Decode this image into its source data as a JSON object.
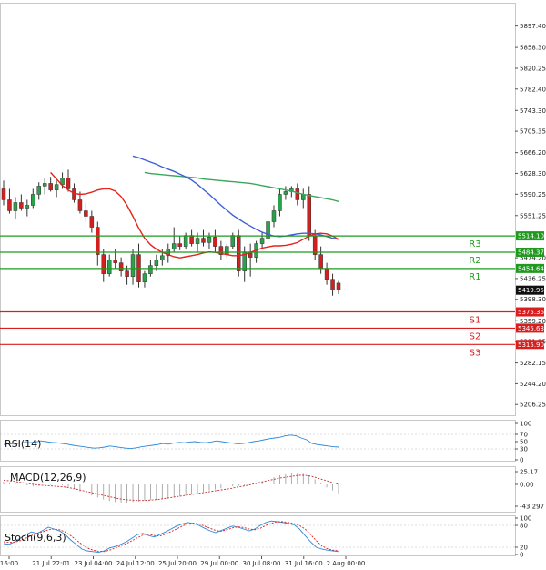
{
  "colors": {
    "bull": "#2aa14a",
    "bear": "#d21f1f",
    "ma_fast": "#e3241c",
    "ma_mid": "#3d5fd8",
    "ma_slow": "#3aa85a",
    "resistance": "#1f9a1f",
    "support": "#d81e1e",
    "rsi": "#2c86d8",
    "stoch_main": "#2c86d8",
    "stoch_signal": "#d81e1e",
    "hist": "#c33333"
  },
  "chart_data": [
    {
      "type": "candlestick",
      "name": "price",
      "y_ticks": [
        "5897.40",
        "5858.30",
        "5820.25",
        "5782.40",
        "5743.30",
        "5705.35",
        "5666.20",
        "5628.30",
        "5590.25",
        "5551.25",
        "5474.20",
        "5436.25",
        "5398.30",
        "5359.20",
        "5321.25",
        "5282.15",
        "5244.20",
        "5206.25"
      ],
      "ylim": [
        5190,
        5935
      ],
      "x_ticks": [
        "16:00",
        "21 Jul 22:01",
        "23 Jul 04:00",
        "24 Jul 12:00",
        "25 Jul 20:00",
        "29 Jul 00:00",
        "30 Jul 08:00",
        "31 Jul 16:00",
        "2 Aug 00:00"
      ],
      "candles": [
        [
          5600,
          5615,
          5570,
          5580
        ],
        [
          5580,
          5600,
          5555,
          5560
        ],
        [
          5560,
          5585,
          5545,
          5575
        ],
        [
          5575,
          5590,
          5560,
          5565
        ],
        [
          5565,
          5580,
          5550,
          5570
        ],
        [
          5570,
          5600,
          5565,
          5590
        ],
        [
          5590,
          5612,
          5580,
          5605
        ],
        [
          5605,
          5620,
          5590,
          5610
        ],
        [
          5610,
          5622,
          5595,
          5598
        ],
        [
          5598,
          5615,
          5585,
          5608
        ],
        [
          5608,
          5630,
          5600,
          5620
        ],
        [
          5620,
          5635,
          5595,
          5600
        ],
        [
          5600,
          5610,
          5575,
          5580
        ],
        [
          5580,
          5595,
          5555,
          5560
        ],
        [
          5560,
          5575,
          5540,
          5550
        ],
        [
          5550,
          5560,
          5520,
          5530
        ],
        [
          5530,
          5540,
          5460,
          5480
        ],
        [
          5480,
          5490,
          5430,
          5445
        ],
        [
          5445,
          5480,
          5440,
          5470
        ],
        [
          5470,
          5490,
          5455,
          5465
        ],
        [
          5465,
          5475,
          5440,
          5450
        ],
        [
          5450,
          5460,
          5425,
          5440
        ],
        [
          5440,
          5490,
          5425,
          5480
        ],
        [
          5480,
          5500,
          5420,
          5430
        ],
        [
          5430,
          5450,
          5420,
          5445
        ],
        [
          5445,
          5470,
          5440,
          5460
        ],
        [
          5460,
          5480,
          5450,
          5470
        ],
        [
          5470,
          5490,
          5460,
          5478
        ],
        [
          5478,
          5500,
          5465,
          5490
        ],
        [
          5490,
          5530,
          5485,
          5500
        ],
        [
          5500,
          5515,
          5488,
          5495
        ],
        [
          5495,
          5520,
          5490,
          5515
        ],
        [
          5515,
          5525,
          5495,
          5500
        ],
        [
          5500,
          5520,
          5485,
          5510
        ],
        [
          5510,
          5525,
          5495,
          5502
        ],
        [
          5502,
          5520,
          5490,
          5512
        ],
        [
          5512,
          5525,
          5485,
          5495
        ],
        [
          5495,
          5505,
          5470,
          5480
        ],
        [
          5480,
          5500,
          5475,
          5495
        ],
        [
          5495,
          5520,
          5490,
          5515
        ],
        [
          5515,
          5525,
          5440,
          5450
        ],
        [
          5450,
          5495,
          5430,
          5485
        ],
        [
          5485,
          5500,
          5440,
          5475
        ],
        [
          5475,
          5505,
          5465,
          5500
        ],
        [
          5500,
          5520,
          5490,
          5510
        ],
        [
          5510,
          5545,
          5505,
          5540
        ],
        [
          5540,
          5570,
          5530,
          5560
        ],
        [
          5560,
          5600,
          5550,
          5590
        ],
        [
          5590,
          5605,
          5580,
          5595
        ],
        [
          5595,
          5605,
          5585,
          5600
        ],
        [
          5600,
          5610,
          5570,
          5580
        ],
        [
          5580,
          5600,
          5565,
          5590
        ],
        [
          5590,
          5605,
          5505,
          5515
        ],
        [
          5515,
          5525,
          5470,
          5480
        ],
        [
          5480,
          5495,
          5445,
          5455
        ],
        [
          5455,
          5465,
          5425,
          5435
        ],
        [
          5435,
          5445,
          5405,
          5415
        ],
        [
          5428,
          5432,
          5408,
          5415
        ]
      ],
      "ma_fast": [
        5630,
        5618,
        5606,
        5598,
        5592,
        5590,
        5591,
        5594,
        5598,
        5600,
        5600,
        5596,
        5586,
        5570,
        5550,
        5528,
        5510,
        5498,
        5490,
        5484,
        5480,
        5476,
        5474,
        5476,
        5478,
        5480,
        5483,
        5485,
        5484,
        5482,
        5480,
        5478,
        5478,
        5480,
        5484,
        5488,
        5492,
        5494,
        5496,
        5496,
        5497,
        5499,
        5502,
        5508,
        5514,
        5518,
        5519,
        5518,
        5514,
        5508
      ],
      "ma_mid": [
        5660,
        5657,
        5653,
        5649,
        5645,
        5640,
        5636,
        5632,
        5627,
        5622,
        5616,
        5608,
        5599,
        5590,
        5580,
        5570,
        5561,
        5552,
        5545,
        5538,
        5532,
        5526,
        5521,
        5517,
        5514,
        5513,
        5514,
        5516,
        5518,
        5519,
        5519,
        5518,
        5516,
        5513,
        5510,
        5508
      ],
      "ma_slow": [
        5630,
        5628,
        5627,
        5626,
        5625,
        5624,
        5623,
        5622,
        5621,
        5620,
        5618,
        5617,
        5616,
        5615,
        5614,
        5613,
        5612,
        5611,
        5610,
        5608,
        5606,
        5604,
        5602,
        5600,
        5598,
        5596,
        5593,
        5590,
        5588,
        5586,
        5584,
        5582,
        5580,
        5577
      ],
      "resistance": [
        {
          "label": "R3",
          "value": 5514.1,
          "tag": "5514.10"
        },
        {
          "label": "R2",
          "value": 5484.37,
          "tag": "5484.37"
        },
        {
          "label": "R1",
          "value": 5454.64,
          "tag": "5454.64"
        }
      ],
      "support": [
        {
          "label": "S1",
          "value": 5375.36,
          "tag": "5375.36"
        },
        {
          "label": "S2",
          "value": 5345.63,
          "tag": "5345.63"
        },
        {
          "label": "S3",
          "value": 5315.9,
          "tag": "5315.90"
        }
      ],
      "current_price": "5419.95"
    },
    {
      "type": "line",
      "name": "RSI(14)",
      "y_ticks": [
        "100",
        "70",
        "50",
        "30",
        "0"
      ],
      "ylim": [
        0,
        100
      ],
      "values": [
        42,
        44,
        43,
        46,
        48,
        47,
        49,
        52,
        50,
        48,
        47,
        45,
        43,
        40,
        38,
        36,
        34,
        32,
        33,
        35,
        38,
        36,
        34,
        32,
        31,
        33,
        36,
        38,
        40,
        42,
        45,
        43,
        46,
        48,
        47,
        49,
        50,
        48,
        47,
        49,
        52,
        50,
        48,
        46,
        44,
        45,
        47,
        50,
        52,
        55,
        58,
        60,
        62,
        66,
        68,
        66,
        60,
        55,
        45,
        42,
        40,
        38,
        36,
        35
      ]
    },
    {
      "type": "bar",
      "name": "MACD(12,26,9)",
      "y_ticks": [
        "25.17",
        "0.00",
        "-43.297"
      ],
      "ylim": [
        -43.297,
        25.17
      ],
      "values": [
        5,
        4,
        2,
        0,
        -2,
        -4,
        -3,
        -2,
        -1,
        0,
        -2,
        -5,
        -9,
        -14,
        -18,
        -22,
        -26,
        -30,
        -33,
        -35,
        -36,
        -36,
        -35,
        -34,
        -32,
        -31,
        -30,
        -29,
        -28,
        -26,
        -24,
        -22,
        -20,
        -18,
        -15,
        -12,
        -10,
        -8,
        -6,
        -4,
        -3,
        -2,
        -1,
        2,
        6,
        10,
        14,
        18,
        20,
        22,
        23,
        21,
        18,
        10,
        2,
        -6,
        -12,
        -18
      ],
      "signal": [
        8,
        7,
        5,
        3,
        1,
        -1,
        -2,
        -3,
        -4,
        -5,
        -7,
        -10,
        -13,
        -16,
        -19,
        -22,
        -25,
        -28,
        -30,
        -31,
        -32,
        -32,
        -31,
        -30,
        -28,
        -26,
        -24,
        -22,
        -20,
        -18,
        -16,
        -14,
        -12,
        -10,
        -8,
        -5,
        -3,
        0,
        3,
        6,
        9,
        12,
        14,
        16,
        18,
        18,
        16,
        12,
        8,
        4,
        0
      ]
    },
    {
      "type": "line",
      "name": "Stoch(9,6,3)",
      "y_ticks": [
        "100",
        "80",
        "20",
        "0"
      ],
      "ylim": [
        0,
        100
      ],
      "values": [
        30,
        28,
        35,
        45,
        55,
        62,
        58,
        66,
        75,
        70,
        65,
        55,
        40,
        28,
        15,
        10,
        8,
        6,
        10,
        18,
        22,
        28,
        35,
        45,
        55,
        58,
        52,
        48,
        55,
        62,
        70,
        78,
        84,
        88,
        85,
        80,
        72,
        65,
        60,
        66,
        72,
        78,
        75,
        70,
        65,
        70,
        80,
        88,
        92,
        90,
        88,
        85,
        82,
        70,
        52,
        35,
        20,
        15,
        12,
        10,
        8
      ],
      "signal": [
        35,
        33,
        34,
        38,
        45,
        52,
        58,
        62,
        68,
        70,
        68,
        62,
        52,
        40,
        28,
        18,
        12,
        9,
        8,
        12,
        18,
        24,
        30,
        38,
        46,
        54,
        56,
        52,
        51,
        56,
        63,
        70,
        78,
        84,
        86,
        84,
        78,
        72,
        66,
        64,
        68,
        73,
        76,
        74,
        70,
        68,
        72,
        80,
        86,
        90,
        90,
        88,
        85,
        80,
        70,
        55,
        38,
        24,
        16,
        12,
        10
      ]
    }
  ]
}
